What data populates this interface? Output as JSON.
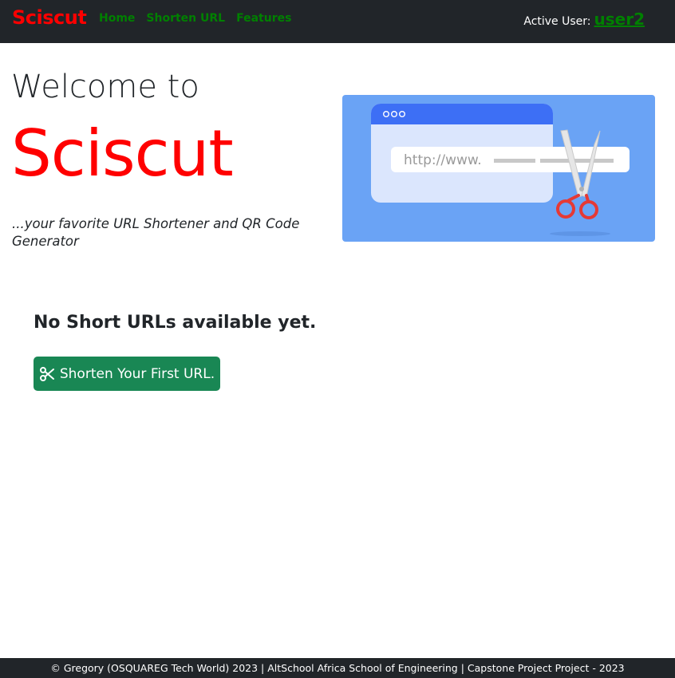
{
  "navbar": {
    "brand": "Sciscut",
    "links": [
      "Home",
      "Shorten URL",
      "Features"
    ],
    "active_user_label": "Active User:",
    "active_user_name": "user2"
  },
  "hero": {
    "welcome": "Welcome to",
    "brand": "Sciscut",
    "tagline": "...your favorite URL Shortener and QR Code Generator",
    "illustration": {
      "url_text": "http://www.",
      "icon": "scissors-cutting-url-illustration"
    }
  },
  "empty_state": {
    "message": "No Short URLs available yet.",
    "button_label": "Shorten Your First URL.",
    "button_icon": "scissors-icon"
  },
  "footer": {
    "text": "© Gregory (OSQUAREG Tech World) 2023 | AltSchool Africa School of Engineering | Capstone Project Project - 2023"
  },
  "colors": {
    "navbar_bg": "#212529",
    "brand_red": "#ff0000",
    "nav_green": "#008000",
    "button_green": "#198754",
    "illustration_bg": "#6aa3f5"
  }
}
